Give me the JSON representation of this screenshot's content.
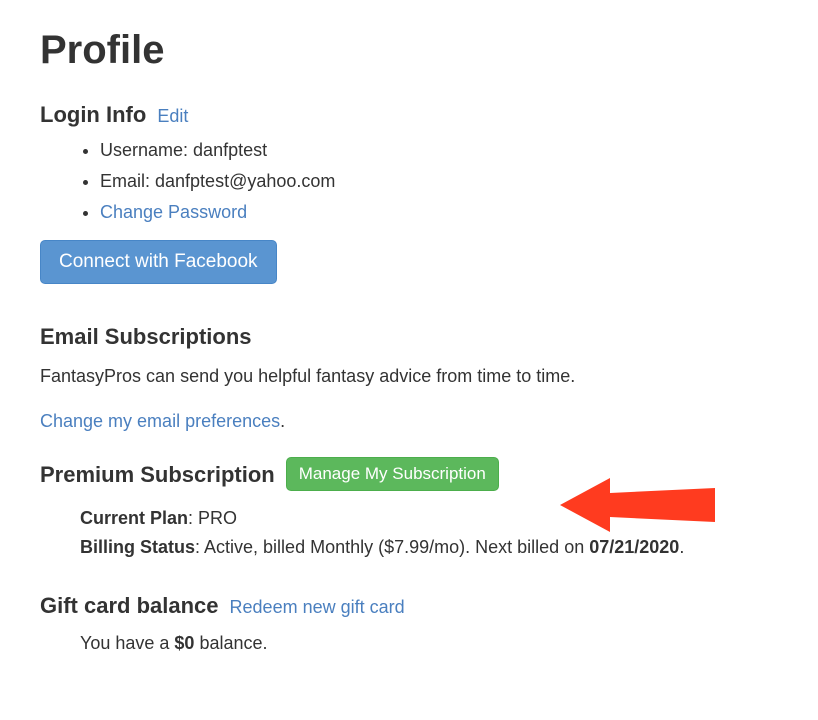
{
  "page": {
    "title": "Profile"
  },
  "login": {
    "heading": "Login Info",
    "edit_label": "Edit",
    "username_label": "Username: ",
    "username_value": "danfptest",
    "email_label": "Email: ",
    "email_value": "danfptest@yahoo.com",
    "change_pw_label": "Change Password",
    "facebook_btn": "Connect with Facebook"
  },
  "emailsubs": {
    "heading": "Email Subscriptions",
    "body": "FantasyPros can send you helpful fantasy advice from time to time.",
    "pref_link": "Change my email preferences",
    "period": "."
  },
  "premium": {
    "heading": "Premium Subscription",
    "manage_btn": "Manage My Subscription",
    "plan_label": "Current Plan",
    "plan_sep": ": ",
    "plan_value": "PRO",
    "billing_label": "Billing Status",
    "billing_sep": ": ",
    "billing_value": "Active, billed Monthly ($7.99/mo). Next billed on ",
    "billing_date": "07/21/2020",
    "billing_period": "."
  },
  "gift": {
    "heading": "Gift card balance",
    "redeem_link": "Redeem new gift card",
    "balance_prefix": "You have a ",
    "balance_amount": "$0",
    "balance_suffix": " balance."
  },
  "colors": {
    "accent": "#4a7fbf",
    "green": "#5cb85c",
    "arrow": "#ff3b1f"
  }
}
